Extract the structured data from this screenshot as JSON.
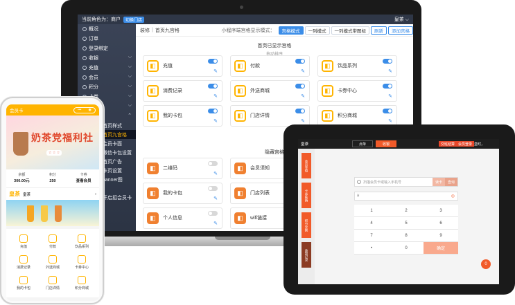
{
  "laptop": {
    "topbar": {
      "role": "当前角色为：商户",
      "chip": "切换门店",
      "store": "皇茶 ⌵"
    },
    "sidebar": [
      {
        "label": "概况"
      },
      {
        "label": "订单"
      },
      {
        "label": "登录绑定"
      },
      {
        "label": "收银"
      },
      {
        "label": "充值"
      },
      {
        "label": "会员"
      },
      {
        "label": "积分"
      },
      {
        "label": "卡券"
      },
      {
        "label": "卡券"
      }
    ],
    "sidebar_sub": [
      "首页样式",
      "首页九宫格",
      "会员卡面",
      "微信卡包设置",
      "首页广告",
      "卡页设置",
      "banner图",
      "",
      "开启招会员卡"
    ],
    "breadcrumb": {
      "section": "装修",
      "page": "首页九宫格",
      "hint": "小程序端宫格显示模式："
    },
    "buttons": {
      "grid": "宫格模式",
      "row1": "一列模式",
      "row1icon": "一列模式带图标",
      "refresh": "刷新",
      "add": "添加宫格"
    },
    "visible_title": "首页已显示宫格",
    "visible_sub": "拖动排序",
    "visible_tiles": [
      {
        "label": "充值",
        "on": true
      },
      {
        "label": "付款",
        "on": true
      },
      {
        "label": "饮品系列",
        "on": true
      },
      {
        "label": "消费记录",
        "on": true
      },
      {
        "label": "外送商城",
        "on": true
      },
      {
        "label": "卡券中心",
        "on": true
      },
      {
        "label": "我的卡包",
        "on": true
      },
      {
        "label": "门店详情",
        "on": true
      },
      {
        "label": "积分商城",
        "on": true
      }
    ],
    "hidden_title": "隐藏宫格",
    "hidden_tiles": [
      {
        "label": "二维码",
        "on": false
      },
      {
        "label": "会员须知",
        "on": false
      },
      {
        "label": "我的卡包",
        "on": false
      },
      {
        "label": "门店列表",
        "on": false
      },
      {
        "label": "个人信息",
        "on": false
      },
      {
        "label": "wifi链接",
        "on": false
      }
    ]
  },
  "phone": {
    "header": "会员卡",
    "banner_text": "奶茶党福利社",
    "stats": [
      {
        "label": "余额",
        "value": "300.00元"
      },
      {
        "label": "积分",
        "value": "250"
      },
      {
        "label": "卡券",
        "value": "查看会员"
      }
    ],
    "store_logo": "皇茶",
    "store_name": "皇茶",
    "grid": [
      "充值",
      "付款",
      "饮品系列",
      "消费记录",
      "外送商城",
      "卡券中心",
      "我的卡包",
      "门店详情",
      "积分商城"
    ]
  },
  "tablet": {
    "brand": "皇茶",
    "tabs": [
      "点单",
      "收银"
    ],
    "top_right": [
      "交班结算",
      "会员登录",
      "皇时，"
    ],
    "side": [
      "会员充值",
      "卡券核销",
      "积分兑换",
      "收银记录"
    ],
    "input_placeholder": "扫描会员卡或输入手机号",
    "input_btn1": "读卡",
    "input_btn2": "查询",
    "amount_symbol": "¥",
    "keys": [
      "1",
      "2",
      "3",
      "4",
      "5",
      "6",
      "7",
      "8",
      "9",
      "•",
      "0",
      "确定"
    ],
    "fab": "0"
  },
  "colors": {
    "accent": "#3b8de8",
    "brand": "#ffb400",
    "tablet_accent": "#f15a29"
  }
}
